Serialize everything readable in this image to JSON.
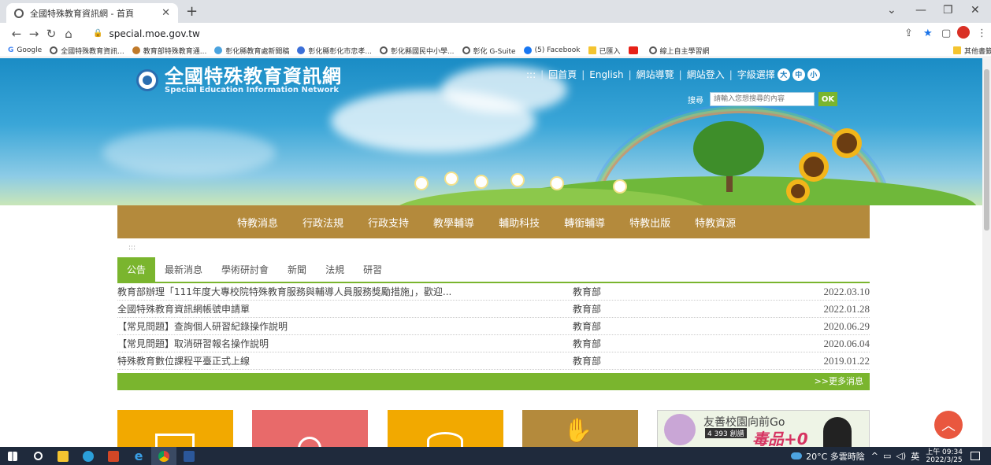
{
  "browser": {
    "tab_title": "全國特殊教育資訊網 - 首頁",
    "url": "special.moe.gov.tw",
    "bookmarks": [
      "Google",
      "全國特殊教育資訊...",
      "教育部特殊教育通...",
      "彰化縣教育處新聞稿",
      "彰化縣彰化市忠孝...",
      "彰化縣國民中小學...",
      "彰化 G-Suite",
      "(5) Facebook",
      "已匯入",
      "線上自主學習網",
      "其他書籤"
    ]
  },
  "site": {
    "title": "全國特殊教育資訊網",
    "subtitle": "Special Education Information Network",
    "top_links": [
      ":::",
      "回首頁",
      "English",
      "網站導覽",
      "網站登入",
      "字級選擇"
    ],
    "font_sizes": [
      "大",
      "中",
      "小"
    ],
    "search_label": "搜尋",
    "search_placeholder": "請輸入您想搜尋的內容",
    "search_button": "OK"
  },
  "main_nav": [
    "特教消息",
    "行政法規",
    "行政支持",
    "教學輔導",
    "輔助科技",
    "轉銜輔導",
    "特教出版",
    "特教資源"
  ],
  "news": {
    "anchor": ":::",
    "tabs": [
      "公告",
      "最新消息",
      "學術研討會",
      "新聞",
      "法規",
      "研習"
    ],
    "active_tab": 0,
    "items": [
      {
        "title": "教育部辦理「111年度大專校院特殊教育服務與輔導人員服務獎勵措施」，歡迎...",
        "unit": "教育部",
        "date": "2022.03.10"
      },
      {
        "title": "全國特殊教育資訊網帳號申請單",
        "unit": "教育部",
        "date": "2022.01.28"
      },
      {
        "title": "【常見問題】查詢個人研習紀錄操作說明",
        "unit": "教育部",
        "date": "2020.06.29"
      },
      {
        "title": "【常見問題】取消研習報名操作說明",
        "unit": "教育部",
        "date": "2020.06.04"
      },
      {
        "title": "特殊教育數位課程平臺正式上線",
        "unit": "教育部",
        "date": "2019.01.22"
      }
    ],
    "more": ">>更多消息"
  },
  "banner": {
    "title": "友善校園向前Go",
    "tag": "4 393 創譜",
    "slogan": "毒品+0"
  },
  "taskbar": {
    "weather": "20°C 多雲時陰",
    "ime": "英",
    "time": "上午 09:34",
    "date": "2022/3/25"
  },
  "colors": {
    "accent_green": "#7ab52e",
    "nav_brown": "#b48a3c",
    "sky_blue": "#1a8cc5",
    "totop_red": "#e9573f"
  }
}
